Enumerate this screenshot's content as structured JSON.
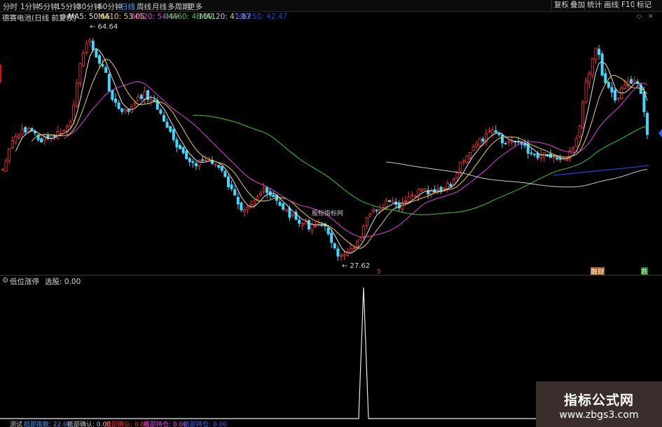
{
  "toolbar": {
    "periods": [
      "分时",
      "1分钟",
      "5分钟",
      "15分钟",
      "30分钟",
      "60分钟",
      "日线",
      "周线",
      "月线",
      "多周期",
      "更多"
    ],
    "active_period": "日线",
    "right_buttons": [
      "复权",
      "叠加",
      "统计",
      "画线",
      "F10",
      "标记"
    ]
  },
  "ma_info": {
    "title": "德赛电池(日线 前复权)",
    "items": [
      {
        "label": "MA5: 50.66",
        "color": "#e6e6e6"
      },
      {
        "label": "MA10: 53.05",
        "color": "#f0d040"
      },
      {
        "label": "MA20: 54.49",
        "color": "#e040e0"
      },
      {
        "label": "MA60: 48.39",
        "color": "#30d030"
      },
      {
        "label": "MA120: 41.87",
        "color": "#c8c8c8"
      },
      {
        "label": "MA250: 42.47",
        "color": "#2040e0"
      }
    ]
  },
  "price_chart": {
    "high_label": "64.64",
    "low_label": "27.62",
    "watermark": "股标指标网",
    "badge_1": "融",
    "badge_2": "财",
    "badge_3": "跌",
    "marker": "5",
    "colors": {
      "up": "#ff3232",
      "down": "#40d8ff",
      "ma5": "#e6e6e6",
      "ma10": "#f0d040",
      "ma20": "#e040e0",
      "ma60": "#30d030",
      "ma120": "#c8c8c8",
      "ma250": "#2040e0"
    }
  },
  "indicator": {
    "name": "低位涨停",
    "param_label": "选股: 0.00",
    "bottom_items": [
      {
        "label": "测试",
        "color": "#c8c8c8"
      },
      {
        "label": "抵部指数: 22.00",
        "color": "#3aa0ff"
      },
      {
        "label": "抵部确认: 0.00",
        "color": "#c8c8c8"
      },
      {
        "label": "抵部确认: 0.00",
        "color": "#ff3030"
      },
      {
        "label": "抵部持仓: 0.00",
        "color": "#ff40ff"
      },
      {
        "label": "抵部持仓: 0.00",
        "color": "#3a6aff"
      }
    ]
  },
  "watermark_box": {
    "title": "指标公式网",
    "url": "www.zbgs3.com"
  }
}
